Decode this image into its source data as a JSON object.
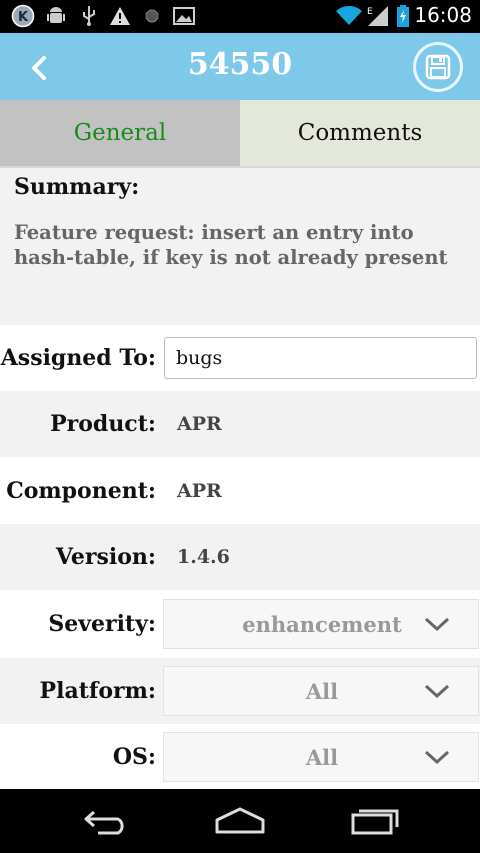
{
  "status_bar": {
    "time": "16:08",
    "icons": [
      "k-app-icon",
      "android-debug-icon",
      "usb-icon",
      "warning-icon",
      "record-dot-icon",
      "image-icon",
      "wifi-icon",
      "signal-icon",
      "battery-charging-icon"
    ],
    "network_type": "E"
  },
  "action_bar": {
    "title": "54550",
    "back_icon": "chevron-left-icon",
    "save_icon": "floppy-disk-icon"
  },
  "tabs": [
    {
      "label": "General",
      "selected": true
    },
    {
      "label": "Comments",
      "selected": false
    }
  ],
  "summary": {
    "label": "Summary:",
    "text": "Feature request: insert an entry into hash-table, if key is not already present"
  },
  "fields": {
    "assigned_to": {
      "label": "Assigned To:",
      "value": "bugs"
    },
    "product": {
      "label": "Product:",
      "value": "APR"
    },
    "component": {
      "label": "Component:",
      "value": "APR"
    },
    "version": {
      "label": "Version:",
      "value": "1.4.6"
    },
    "severity": {
      "label": "Severity:",
      "value": "enhancement"
    },
    "platform": {
      "label": "Platform:",
      "value": "All"
    },
    "os": {
      "label": "OS:",
      "value": "All"
    }
  },
  "nav_bar": {
    "icons": [
      "back-nav-icon",
      "home-nav-icon",
      "recent-apps-icon"
    ]
  },
  "colors": {
    "action_bar": "#7ec8ea",
    "selected_tab_text": "#1a8a1a",
    "selected_tab_bg": "#c2c2c2",
    "unselected_tab_bg": "#e3e8da"
  }
}
